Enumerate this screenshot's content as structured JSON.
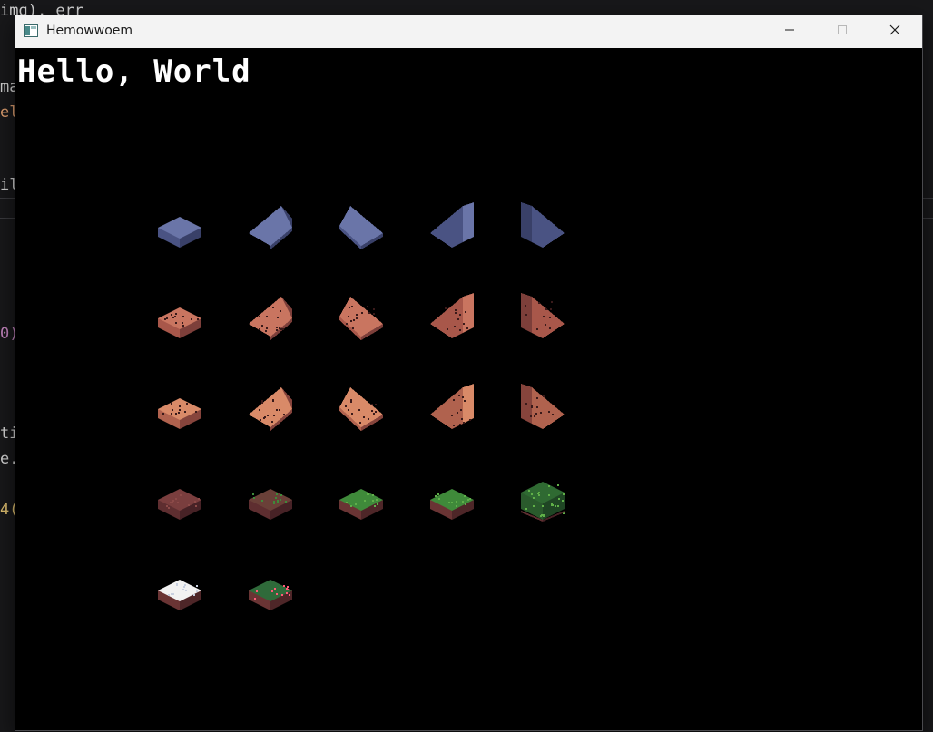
{
  "background_editor": {
    "lines": [
      {
        "text": "img), err",
        "color": "#c8c8c8"
      },
      {
        "text": "ma",
        "color": "#d4d4d4"
      },
      {
        "text": "el",
        "color": "#e0a070"
      },
      {
        "text": "il",
        "color": "#d4d4d4"
      },
      {
        "text": "0)",
        "color": "#c586c0"
      },
      {
        "text": "ti",
        "color": "#d4d4d4"
      },
      {
        "text": "e.",
        "color": "#d4d4d4"
      },
      {
        "text": "4(",
        "color": "#e0c070"
      }
    ]
  },
  "window": {
    "title": "Hemowwoem",
    "icons": {
      "app": "app-window-icon",
      "minimize": "minimize-icon",
      "maximize": "maximize-icon",
      "close": "close-icon"
    },
    "canvas": {
      "greeting": "Hello, World",
      "tiles": [
        {
          "row": 0,
          "col": 0,
          "shape": "flat",
          "palette": "stone"
        },
        {
          "row": 0,
          "col": 1,
          "shape": "slope-left",
          "palette": "stone"
        },
        {
          "row": 0,
          "col": 2,
          "shape": "slope-right",
          "palette": "stone"
        },
        {
          "row": 0,
          "col": 3,
          "shape": "wedge-left",
          "palette": "stone"
        },
        {
          "row": 0,
          "col": 4,
          "shape": "wedge-right",
          "palette": "stone"
        },
        {
          "row": 1,
          "col": 0,
          "shape": "flat",
          "palette": "brick"
        },
        {
          "row": 1,
          "col": 1,
          "shape": "slope-left",
          "palette": "brick"
        },
        {
          "row": 1,
          "col": 2,
          "shape": "slope-right",
          "palette": "brick"
        },
        {
          "row": 1,
          "col": 3,
          "shape": "wedge-left",
          "palette": "brick"
        },
        {
          "row": 1,
          "col": 4,
          "shape": "wedge-right",
          "palette": "brick"
        },
        {
          "row": 2,
          "col": 0,
          "shape": "flat",
          "palette": "brick-light"
        },
        {
          "row": 2,
          "col": 1,
          "shape": "slope-left",
          "palette": "brick-light"
        },
        {
          "row": 2,
          "col": 2,
          "shape": "slope-right",
          "palette": "brick-light"
        },
        {
          "row": 2,
          "col": 3,
          "shape": "wedge-left",
          "palette": "brick-light"
        },
        {
          "row": 2,
          "col": 4,
          "shape": "wedge-right",
          "palette": "brick-light"
        },
        {
          "row": 3,
          "col": 0,
          "shape": "flat",
          "palette": "dirt"
        },
        {
          "row": 3,
          "col": 1,
          "shape": "flat",
          "palette": "dirt-grass"
        },
        {
          "row": 3,
          "col": 2,
          "shape": "flat",
          "palette": "grass"
        },
        {
          "row": 3,
          "col": 3,
          "shape": "flat",
          "palette": "grass"
        },
        {
          "row": 3,
          "col": 4,
          "shape": "cube",
          "palette": "leaves"
        },
        {
          "row": 4,
          "col": 0,
          "shape": "flat",
          "palette": "snow"
        },
        {
          "row": 4,
          "col": 1,
          "shape": "flat",
          "palette": "flowers"
        }
      ],
      "palettes": {
        "stone": {
          "top": "#6a75a8",
          "left": "#4a5383",
          "right": "#394068",
          "dots": ""
        },
        "brick": {
          "top": "#c97560",
          "left": "#a8574a",
          "right": "#7d3f3a",
          "dots": "#3a1a1a"
        },
        "brick-light": {
          "top": "#d98a68",
          "left": "#b0624e",
          "right": "#86443c",
          "dots": "#3a1a1a"
        },
        "dirt": {
          "top": "#7a3e3e",
          "left": "#5e2e30",
          "right": "#472226",
          "dots": "#8c4a48"
        },
        "dirt-grass": {
          "top": "#6a4038",
          "left": "#5e2e30",
          "right": "#472226",
          "dots": "#3f8a3a"
        },
        "grass": {
          "top": "#3f8a3a",
          "left": "#6a3434",
          "right": "#4e2628",
          "dots": "#5fae4a"
        },
        "leaves": {
          "top": "#2f6a32",
          "left": "#2a5a2c",
          "right": "#1f4624",
          "dots": "#60b048"
        },
        "snow": {
          "top": "#f2f2f2",
          "left": "#6a3434",
          "right": "#4e2628",
          "dots": "#c8d0e0"
        },
        "flowers": {
          "top": "#2f6a3a",
          "left": "#6a3434",
          "right": "#4e2628",
          "dots": "#ff5a78"
        }
      }
    }
  }
}
